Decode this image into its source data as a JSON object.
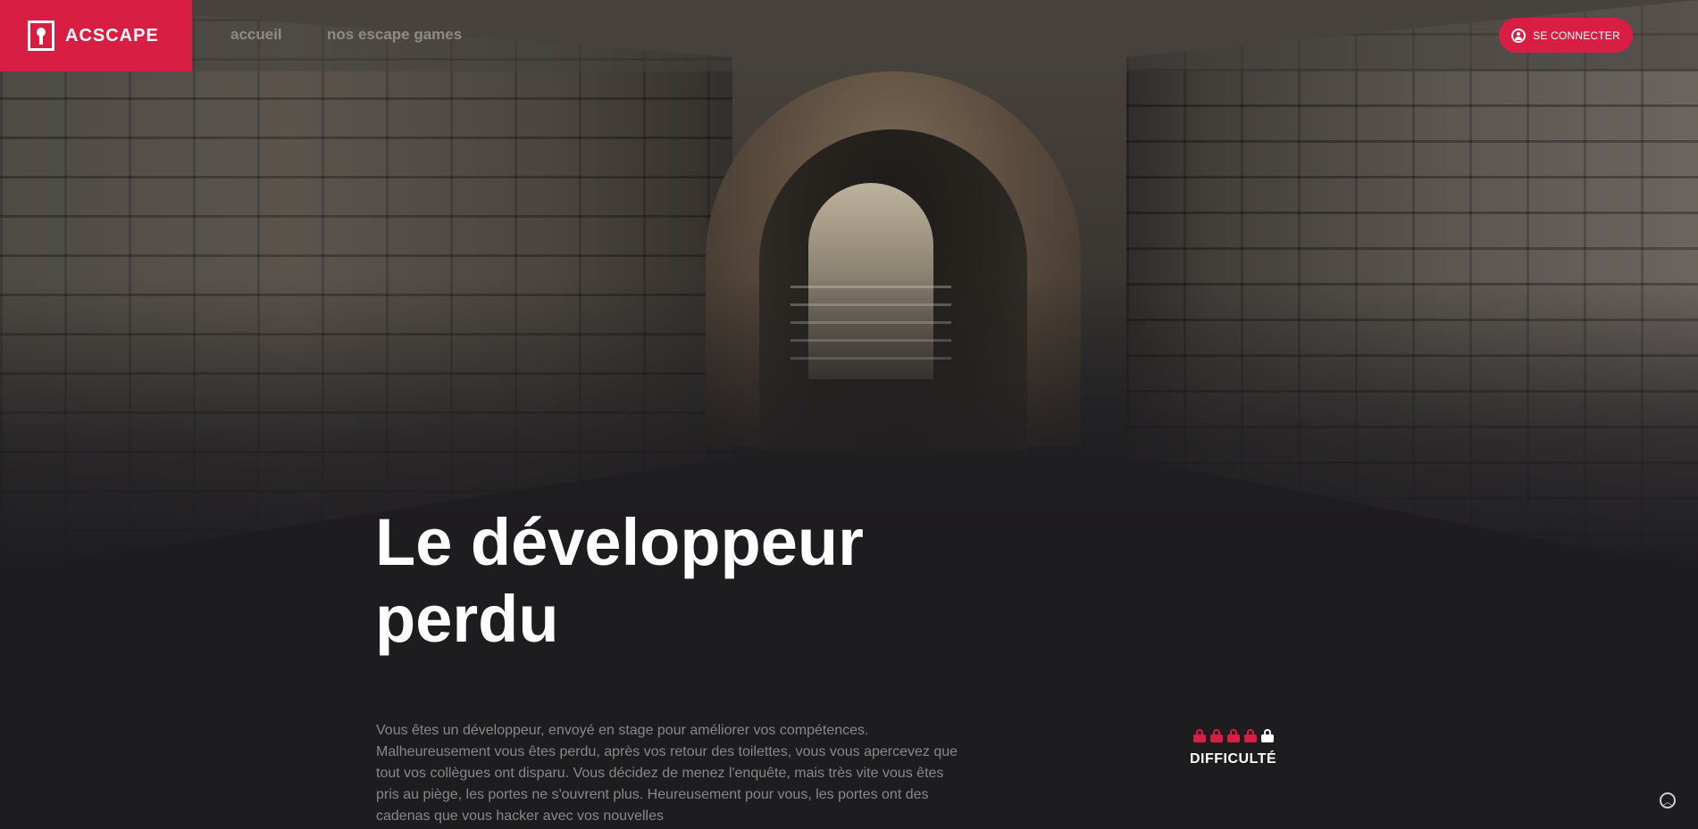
{
  "brand": {
    "name": "ACSCAPE",
    "accent_color": "#d81e43",
    "icon": "keyhole-icon"
  },
  "nav": {
    "links": [
      {
        "label": "accueil"
      },
      {
        "label": "nos escape games"
      }
    ]
  },
  "account": {
    "login_label": "SE CONNECTER",
    "icon": "user-circle-icon"
  },
  "hero": {
    "image": "dungeon-corridor-arch"
  },
  "game": {
    "title_line1": "Le développeur",
    "title_line2": "perdu",
    "description": "Vous êtes un développeur, envoyé en stage pour améliorer vos compétences. Malheureusement vous êtes perdu, après vos retour des toilettes, vous vous apercevez que tout vos collègues ont disparu. Vous décidez de menez l'enquête, mais très vite vous êtes pris au piège, les portes ne s'ouvrent plus. Heureusement pour vous, les portes ont des cadenas que vous hacker avec vos nouvelles",
    "difficulty": {
      "label": "DIFFICULTÉ",
      "level": 4,
      "max": 5
    }
  },
  "scroll_top": {
    "icon": "chevron-up-circle-icon"
  }
}
